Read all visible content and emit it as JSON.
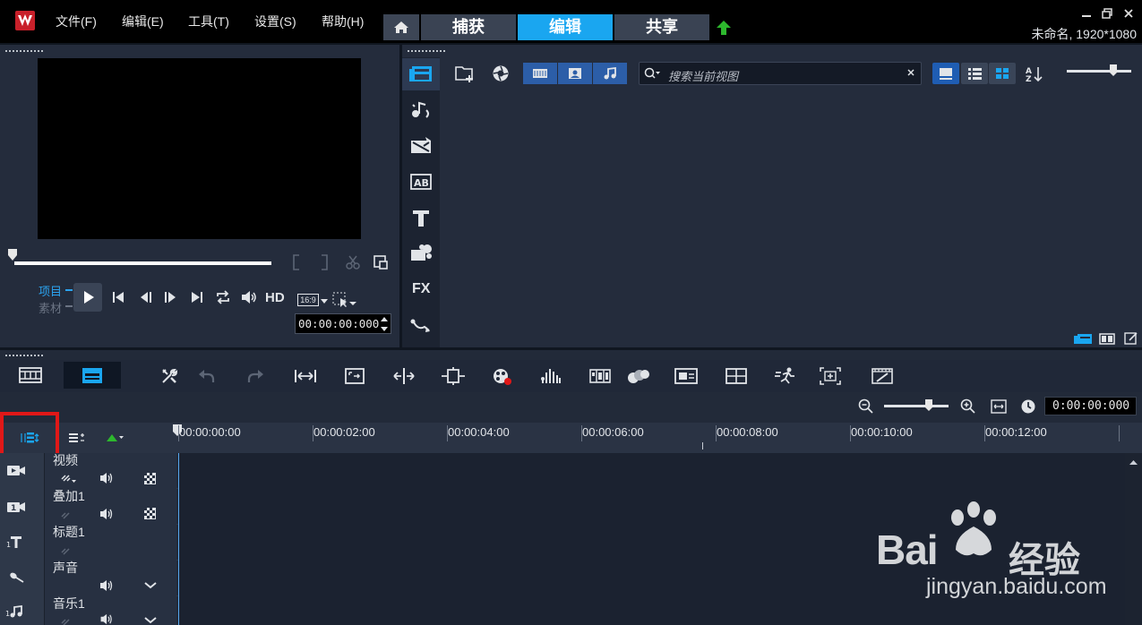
{
  "app": {
    "menu": [
      "文件(F)",
      "编辑(E)",
      "工具(T)",
      "设置(S)",
      "帮助(H)"
    ],
    "steps": [
      "捕获",
      "编辑",
      "共享"
    ],
    "active_step": "编辑",
    "project_info": "未命名, 1920*1080"
  },
  "player": {
    "mode_project": "项目",
    "mode_clip": "素材",
    "hd_label": "HD",
    "aspect_ratio": "16:9",
    "timecode": "00:00:00:000"
  },
  "library": {
    "search_placeholder": "搜索当前视图",
    "side_icons": [
      "media-icon",
      "instant-project-icon",
      "transition-icon",
      "title-icon",
      "text-icon",
      "graphic-icon",
      "filter-fx-icon",
      "path-icon"
    ],
    "fx_label": "FX"
  },
  "timeline": {
    "timecode": "0:00:00:000",
    "ruler": [
      "00:00:00:00",
      "00:00:02:00",
      "00:00:04:00",
      "00:00:06:00",
      "00:00:08:00",
      "00:00:10:00",
      "00:00:12:00"
    ],
    "tracks": [
      {
        "name": "视频"
      },
      {
        "name": "叠加1"
      },
      {
        "name": "标题1"
      },
      {
        "name": "声音"
      },
      {
        "name": "音乐1"
      }
    ]
  },
  "watermark": {
    "brand_left": "Bai",
    "brand_right": "经验",
    "url": "jingyan.baidu.com"
  },
  "colors": {
    "accent": "#1aa6f0",
    "highlight": "#e01818",
    "upload": "#2db82d"
  }
}
